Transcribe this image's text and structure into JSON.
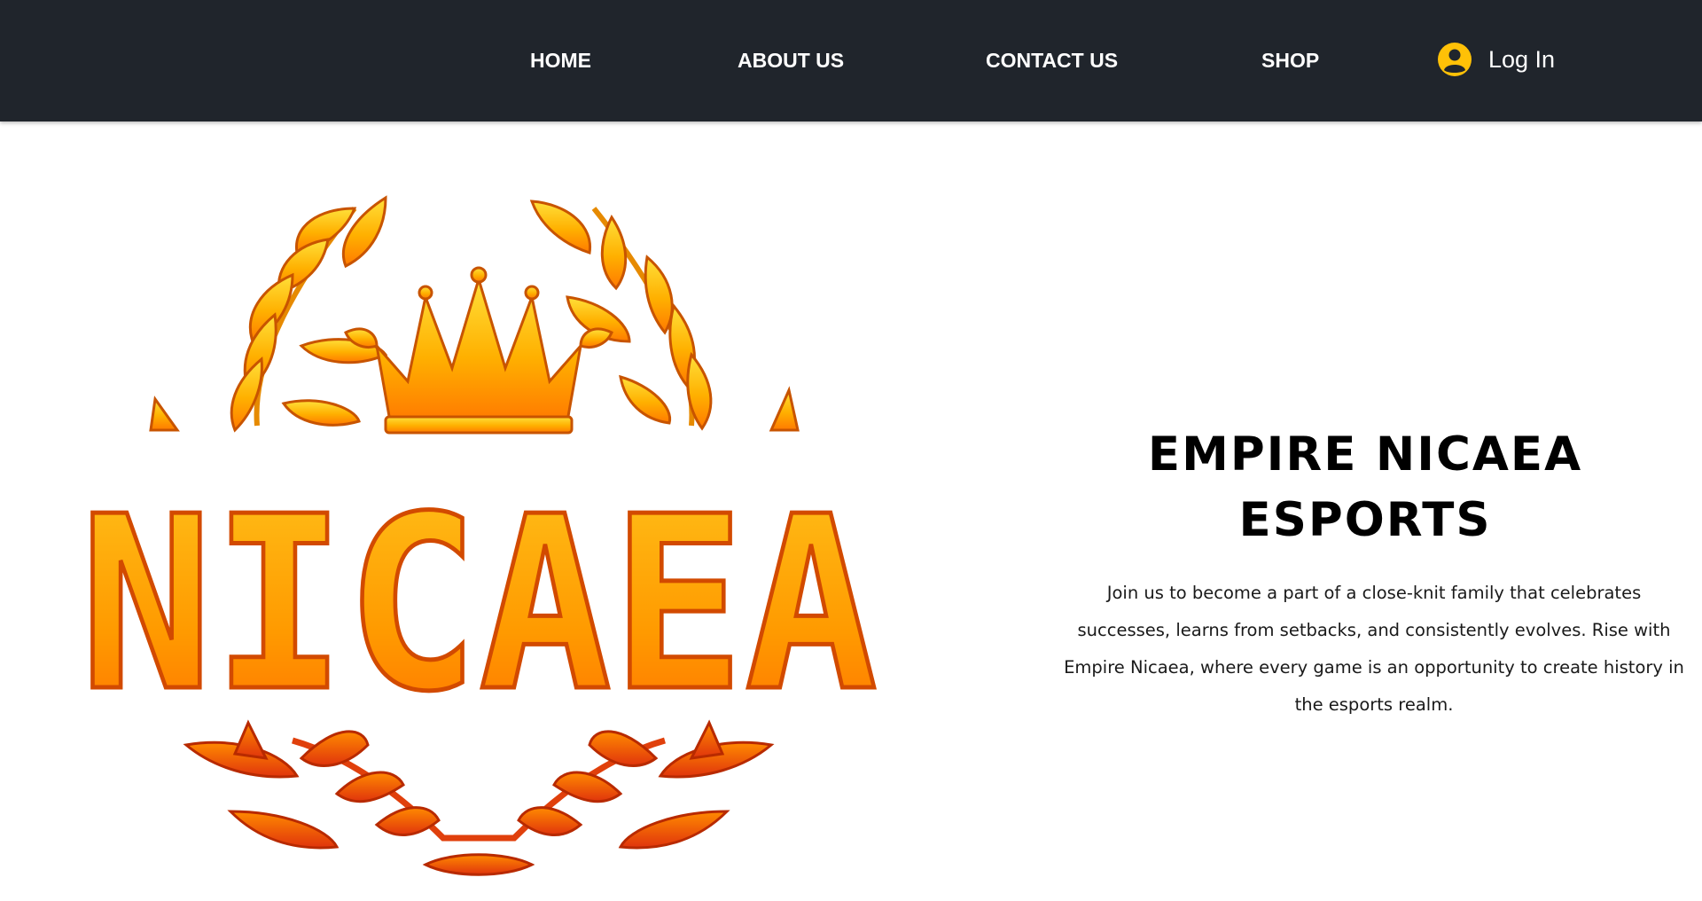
{
  "nav": {
    "items": [
      {
        "label": "HOME"
      },
      {
        "label": "ABOUT US"
      },
      {
        "label": "CONTACT US"
      },
      {
        "label": "SHOP"
      }
    ],
    "login_label": "Log In",
    "login_icon": "user-avatar-icon"
  },
  "hero": {
    "logo_text": "NICAEA",
    "title_line1": "EMPIRE NICAEA",
    "title_line2": "ESPORTS",
    "body": "Join us to become a part of a close-knit family that celebrates successes, learns from setbacks, and consistently evolves. Rise with Empire Nicaea, where every game is an opportunity to create history in the esports realm."
  },
  "colors": {
    "header_bg": "#20252c",
    "accent_gold": "#ffc107",
    "logo_orange": "#ff8c00",
    "logo_red": "#e0340c"
  }
}
